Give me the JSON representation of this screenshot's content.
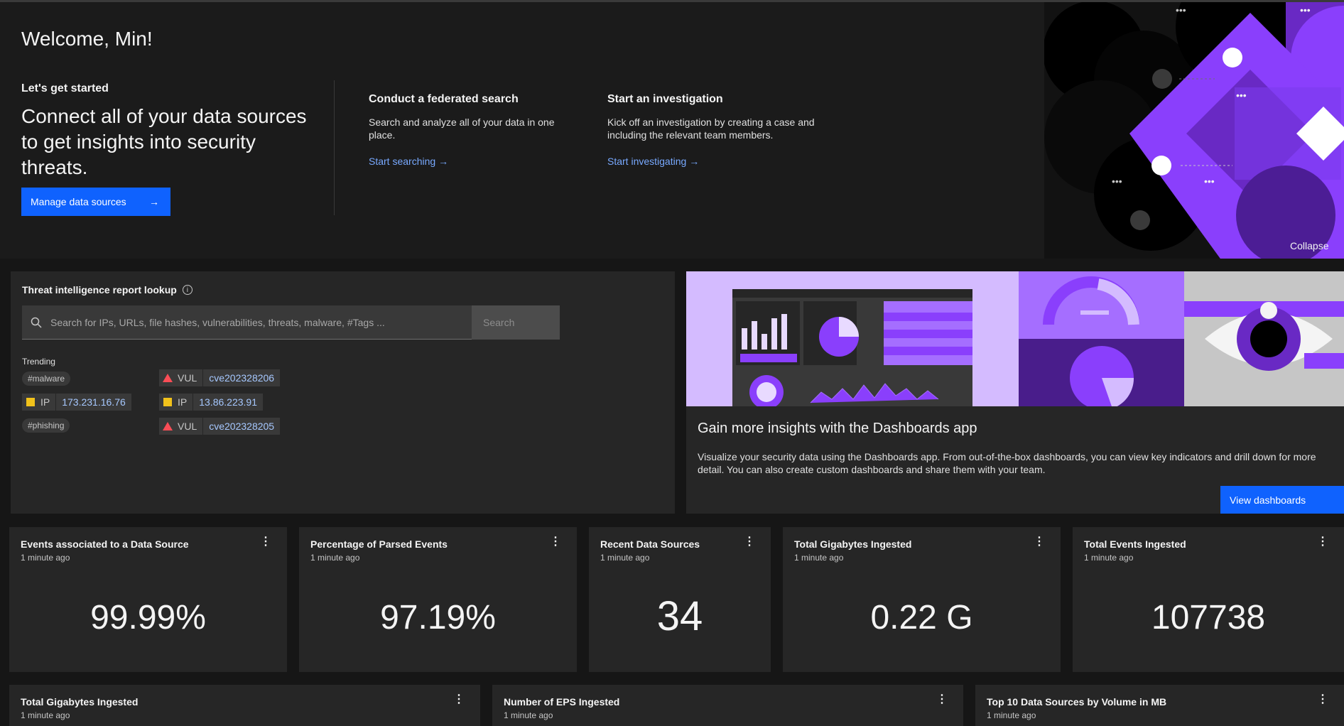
{
  "welcome": "Welcome, Min!",
  "getting_started": {
    "label": "Let's get started",
    "headline": "Connect all of your data sources to get insights into security threats.",
    "button": "Manage data sources"
  },
  "federated": {
    "title": "Conduct a federated search",
    "desc": "Search and analyze all of your data in one place.",
    "link": "Start searching"
  },
  "investigation": {
    "title": "Start an investigation",
    "desc": "Kick off an investigation by creating a case and including the relevant team members.",
    "link": "Start investigating"
  },
  "collapse": "Collapse",
  "threat_lookup": {
    "title": "Threat intelligence report lookup",
    "placeholder": "Search for IPs, URLs, file hashes, vulnerabilities, threats, malware, #Tags ...",
    "search_button": "Search",
    "trending_label": "Trending",
    "tags": [
      "#malware",
      "#phishing"
    ],
    "chips": [
      {
        "type": "IP",
        "value": "173.231.16.76"
      },
      {
        "type": "VUL",
        "value": "cve202328206"
      },
      {
        "type": "IP",
        "value": "13.86.223.91"
      },
      {
        "type": "VUL",
        "value": "cve202328205"
      }
    ]
  },
  "dashboards": {
    "title": "Gain more insights with the Dashboards app",
    "desc": "Visualize your security data using the Dashboards app. From out-of-the-box dashboards, you can view key indicators and drill down for more detail. You can also create custom dashboards and share them with your team.",
    "button": "View dashboards"
  },
  "cards": [
    {
      "title": "Events associated to a Data Source",
      "ago": "1 minute ago",
      "value": "99.99%"
    },
    {
      "title": "Percentage of Parsed Events",
      "ago": "1 minute ago",
      "value": "97.19%"
    },
    {
      "title": "Recent Data Sources",
      "ago": "1 minute ago",
      "value": "34"
    },
    {
      "title": "Total Gigabytes Ingested",
      "ago": "1 minute ago",
      "value": "0.22 G"
    },
    {
      "title": "Total Events Ingested",
      "ago": "1 minute ago",
      "value": "107738"
    }
  ],
  "bottom_cards": [
    {
      "title": "Total Gigabytes Ingested",
      "ago": "1 minute ago"
    },
    {
      "title": "Number of EPS Ingested",
      "ago": "1 minute ago"
    },
    {
      "title": "Top 10 Data Sources by Volume in MB",
      "ago": "1 minute ago"
    }
  ],
  "colors": {
    "primary": "#0f62fe",
    "link": "#78a9ff",
    "warning": "#f1c21b",
    "danger": "#fa4d56",
    "accent": "#8a3ffc"
  }
}
